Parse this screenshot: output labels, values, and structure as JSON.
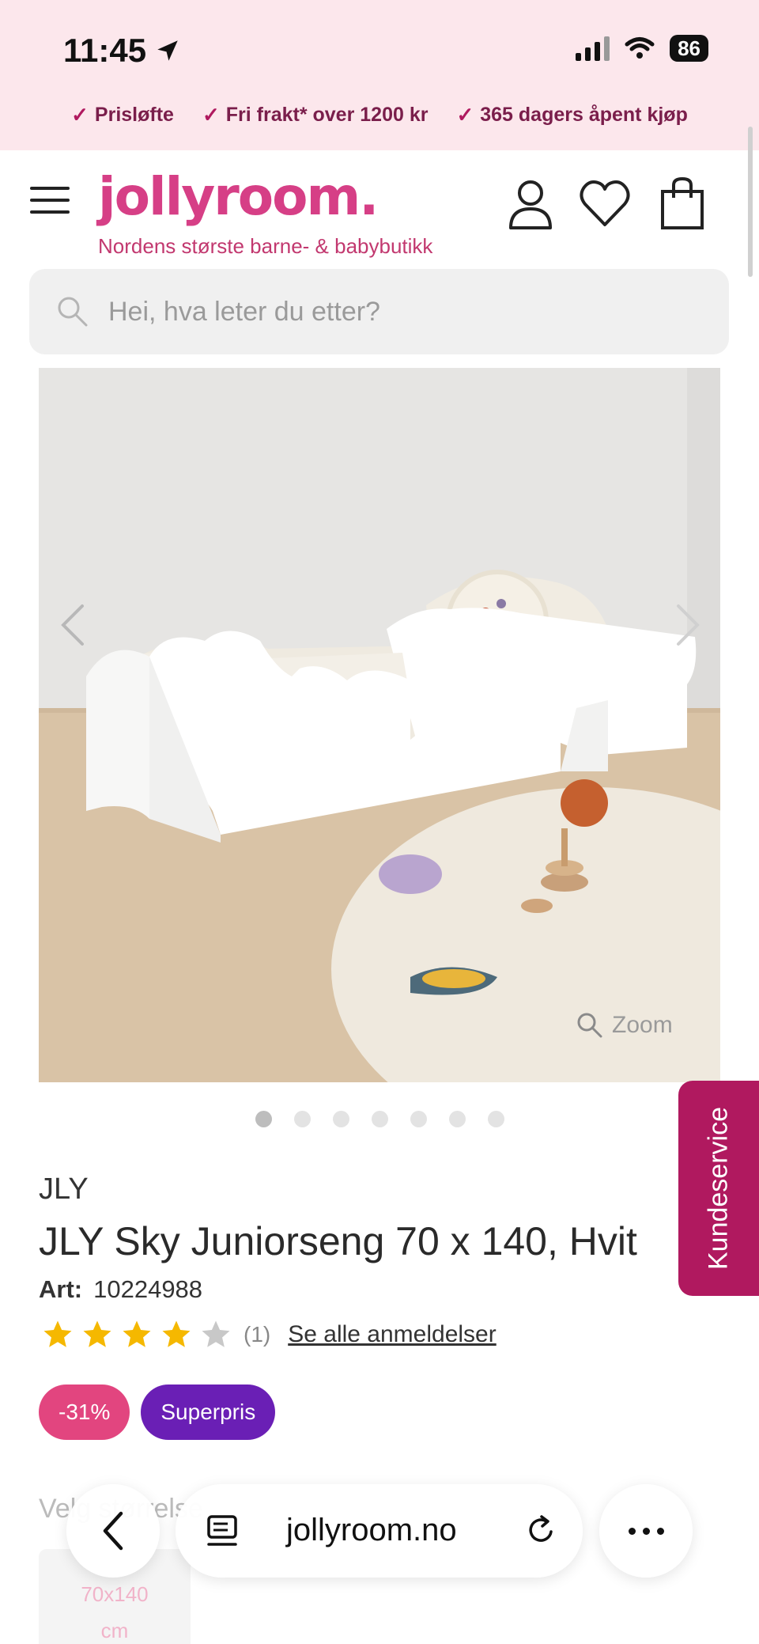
{
  "status_bar": {
    "time": "11:45",
    "battery": "86"
  },
  "usp": [
    "Prisløfte",
    "Fri frakt* over 1200 kr",
    "365 dagers åpent kjøp"
  ],
  "header": {
    "logo": "jollyroom.",
    "tagline": "Nordens største barne- & babybutikk"
  },
  "search": {
    "placeholder": "Hei, hva leter du etter?"
  },
  "gallery": {
    "zoom_label": "Zoom",
    "dot_count": 7,
    "active_index": 0
  },
  "product": {
    "brand": "JLY",
    "title": "JLY Sky Juniorseng 70 x 140, Hvit",
    "art_label": "Art:",
    "art_number": "10224988",
    "rating": 4,
    "rating_max": 5,
    "review_count": "(1)",
    "review_link": "Se alle anmeldelser",
    "badges": [
      {
        "label": "-31%",
        "color": "#e2457f"
      },
      {
        "label": "Superpris",
        "color": "#6a1fb5"
      }
    ]
  },
  "kundeservice": "Kundeservice",
  "variant": {
    "label": "Velg størrelse",
    "option_line1": "70x140",
    "option_line2": "cm"
  },
  "browser": {
    "url": "jollyroom.no"
  },
  "colors": {
    "brand_pink": "#d63f86",
    "banner_bg": "#fce7ec",
    "service_tab": "#b0195f",
    "star": "#f5b800"
  }
}
